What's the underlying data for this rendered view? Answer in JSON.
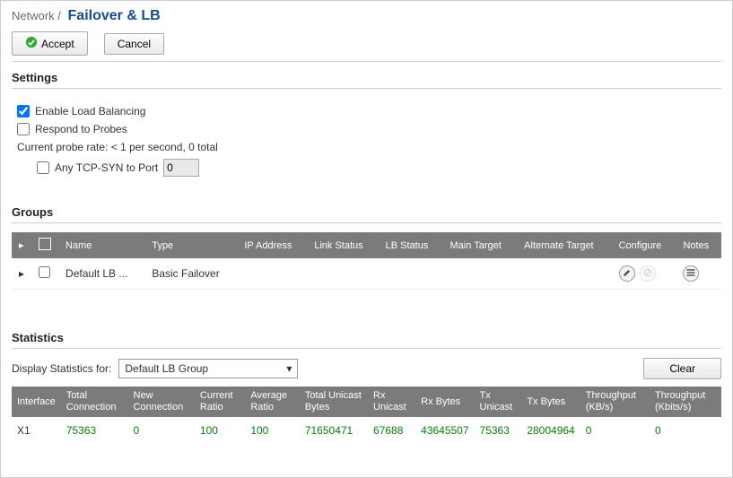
{
  "breadcrumb": {
    "parent": "Network /",
    "title": "Failover & LB"
  },
  "buttons": {
    "accept": "Accept",
    "cancel": "Cancel",
    "clear": "Clear"
  },
  "sections": {
    "settings": "Settings",
    "groups": "Groups",
    "statistics": "Statistics"
  },
  "settings": {
    "enable_lb": {
      "label": "Enable Load Balancing",
      "checked": true
    },
    "respond": {
      "label": "Respond to Probes",
      "checked": false
    },
    "probe_rate": "Current probe rate: < 1 per second, 0 total",
    "tcp_syn": {
      "label": "Any TCP-SYN to Port",
      "checked": false,
      "value": "0"
    }
  },
  "groups": {
    "headers": [
      "",
      "",
      "Name",
      "Type",
      "IP Address",
      "Link Status",
      "LB Status",
      "Main Target",
      "Alternate Target",
      "Configure",
      "Notes"
    ],
    "rows": [
      {
        "name": "Default LB ...",
        "type": "Basic Failover",
        "ip": "",
        "link": "",
        "lb": "",
        "main": "",
        "alt": ""
      }
    ]
  },
  "stats": {
    "display_label": "Display Statistics for:",
    "selected": "Default LB Group",
    "headers": [
      "Interface",
      "Total Connection",
      "New Connection",
      "Current Ratio",
      "Average Ratio",
      "Total Unicast Bytes",
      "Rx Unicast",
      "Rx Bytes",
      "Tx Unicast",
      "Tx Bytes",
      "Throughput (KB/s)",
      "Throughput (Kbits/s)"
    ],
    "rows": [
      {
        "iface": "X1",
        "total_conn": "75363",
        "new_conn": "0",
        "cur_ratio": "100",
        "avg_ratio": "100",
        "total_uni": "71650471",
        "rx_uni": "67688",
        "rx_bytes": "43645507",
        "tx_uni": "75363",
        "tx_bytes": "28004964",
        "tp_kb": "0",
        "tp_kbits": "0"
      }
    ]
  }
}
